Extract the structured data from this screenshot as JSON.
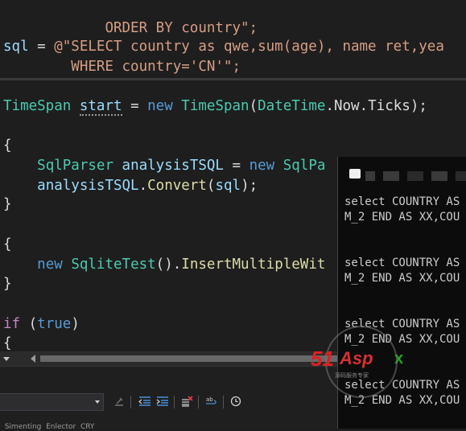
{
  "editor": {
    "lines": {
      "l1": {
        "text": "        ORDER BY country\";"
      },
      "l2": {
        "sql": "sql",
        "eq": " = ",
        "at": "@",
        "str": "\"SELECT country as qwe,sum(age), name ret,yea"
      },
      "l3": {
        "str": "        WHERE country='CN'\";"
      },
      "l4": {
        "type1": "TimeSpan",
        "var": "start",
        "eq": " = ",
        "new": "new",
        "type2": "TimeSpan",
        "open": "(",
        "dt": "DateTime",
        "d1": ".",
        "now": "Now",
        "d2": ".",
        "ticks": "Ticks",
        "close": ");"
      },
      "l5": {
        "brace": "{"
      },
      "l6": {
        "type": "SqlParser",
        "var": "analysisTSQL",
        "eq": " = ",
        "new": "new",
        "type2": "SqlPa"
      },
      "l7": {
        "var": "analysisTSQL",
        "dot": ".",
        "fn": "Convert",
        "open": "(",
        "arg": "sql",
        "close": ");"
      },
      "l8": {
        "brace": "}"
      },
      "l9": {
        "brace": "{"
      },
      "l10": {
        "new": "new",
        "type": "SqliteTest",
        "paren": "()",
        "dot": ".",
        "fn": "InsertMultipleWit"
      },
      "l11": {
        "brace": "}"
      },
      "l12": {
        "if": "if",
        "open": " (",
        "val": "true",
        "close": ")"
      },
      "l13": {
        "brace": "{"
      }
    }
  },
  "console": {
    "lines": [
      "select COUNTRY AS",
      "M_2 END AS XX,COU",
      "select COUNTRY AS",
      "M_2 END AS XX,COU",
      "select COUNTRY AS",
      "M_2 END AS XX,COU",
      "select COUNTRY AS",
      "M_2 END AS XX,COU"
    ]
  },
  "bottom": {
    "status_text": "  Simenting  Enlector  CRY"
  },
  "watermark": {
    "brand_51": "51",
    "brand_aspx": "Asp",
    "brand_x": "x",
    "subtitle": "源码服务专家"
  },
  "colors": {
    "keyword": "#569cd6",
    "type": "#4ec9b0",
    "string": "#d69d85",
    "identifier": "#9cdcfe",
    "method": "#dcdcaa",
    "control": "#c586c0"
  },
  "icons": [
    "window-icon",
    "chevron-down-icon",
    "build-icon",
    "outdent-icon",
    "indent-icon",
    "delete-icon",
    "wrap-icon",
    "clock-icon"
  ]
}
